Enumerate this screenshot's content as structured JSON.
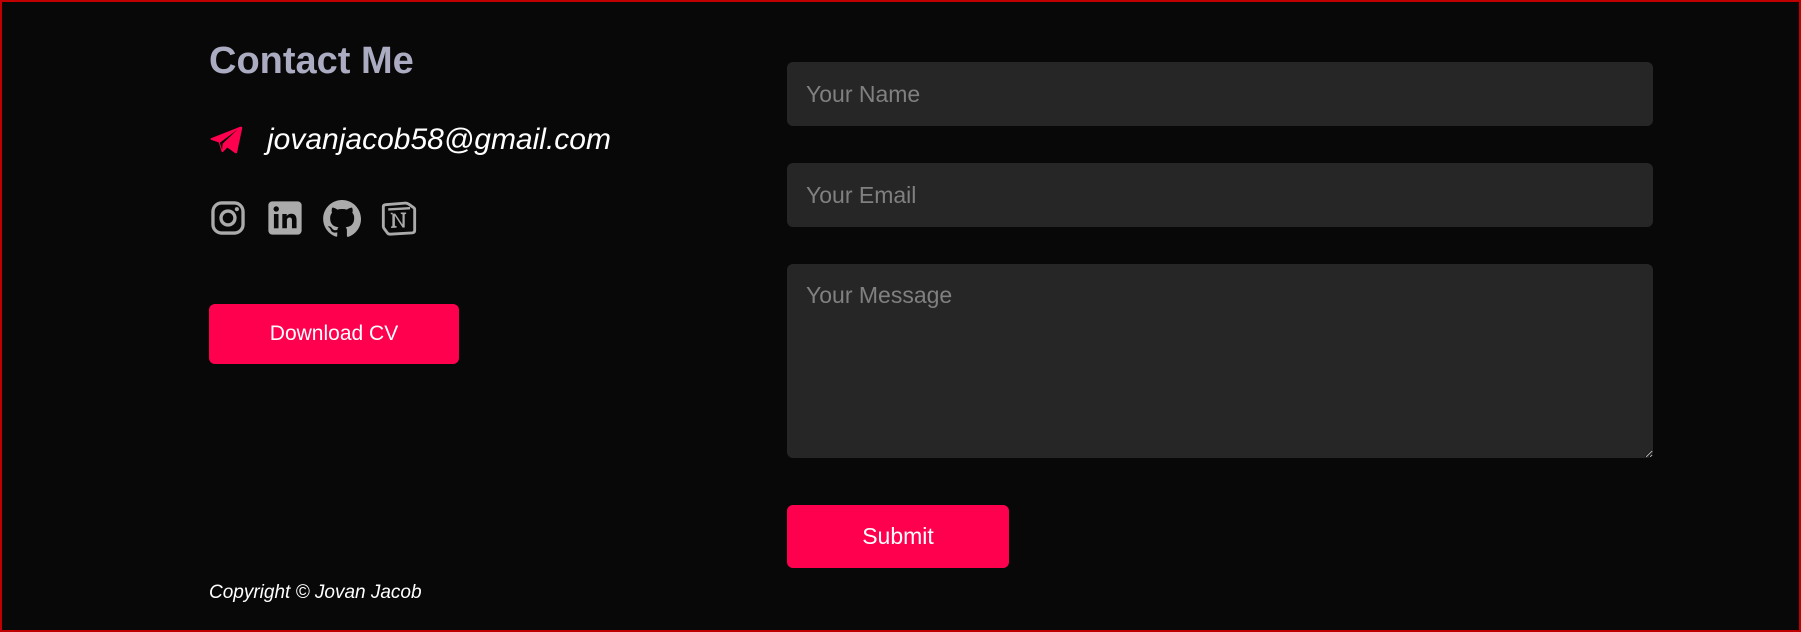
{
  "contact": {
    "title": "Contact Me",
    "email": "jovanjacob58@gmail.com",
    "email_icon": "paper-plane-icon",
    "socials": [
      {
        "name": "instagram",
        "icon": "instagram-icon"
      },
      {
        "name": "linkedin",
        "icon": "linkedin-icon"
      },
      {
        "name": "github",
        "icon": "github-icon"
      },
      {
        "name": "notion",
        "icon": "notion-icon"
      }
    ],
    "download_label": "Download CV",
    "copyright": "Copyright © Jovan Jacob"
  },
  "form": {
    "name_placeholder": "Your Name",
    "email_placeholder": "Your Email",
    "message_placeholder": "Your Message",
    "name_value": "",
    "email_value": "",
    "message_value": "",
    "submit_label": "Submit"
  },
  "colors": {
    "background": "#080808",
    "accent": "#ff004f",
    "heading": "#abacc1",
    "icon": "#ababab",
    "field_background": "#262626",
    "placeholder": "#808080",
    "frame_border": "#c00000"
  }
}
